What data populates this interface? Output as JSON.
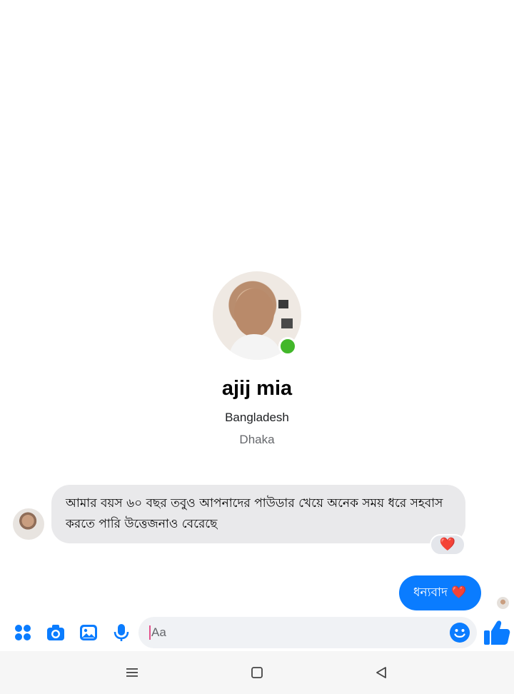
{
  "profile": {
    "name": "ajij mia",
    "country": "Bangladesh",
    "city": "Dhaka",
    "online": true
  },
  "messages": {
    "incoming_text": "আমার বয়স ৬০ বছর তবুও আপনাদের পাউডার খেয়ে অনেক সময় ধরে সহবাস করতে পারি উত্তেজনাও বেরেছে",
    "incoming_reaction": "❤️",
    "outgoing_text": "ধন্যবাদ",
    "outgoing_emoji": "❤️"
  },
  "composer": {
    "placeholder": "Aa",
    "icons": [
      "apps-icon",
      "camera-icon",
      "gallery-icon",
      "microphone-icon",
      "emoji-icon",
      "thumbs-up-icon"
    ]
  },
  "navbar": {
    "icons": [
      "menu-icon",
      "home-icon",
      "back-icon"
    ]
  },
  "colors": {
    "accent": "#0a7cff",
    "incoming_bubble": "#e9e9eb",
    "online": "#42b72a",
    "composer_icon": "#0a7cff"
  }
}
